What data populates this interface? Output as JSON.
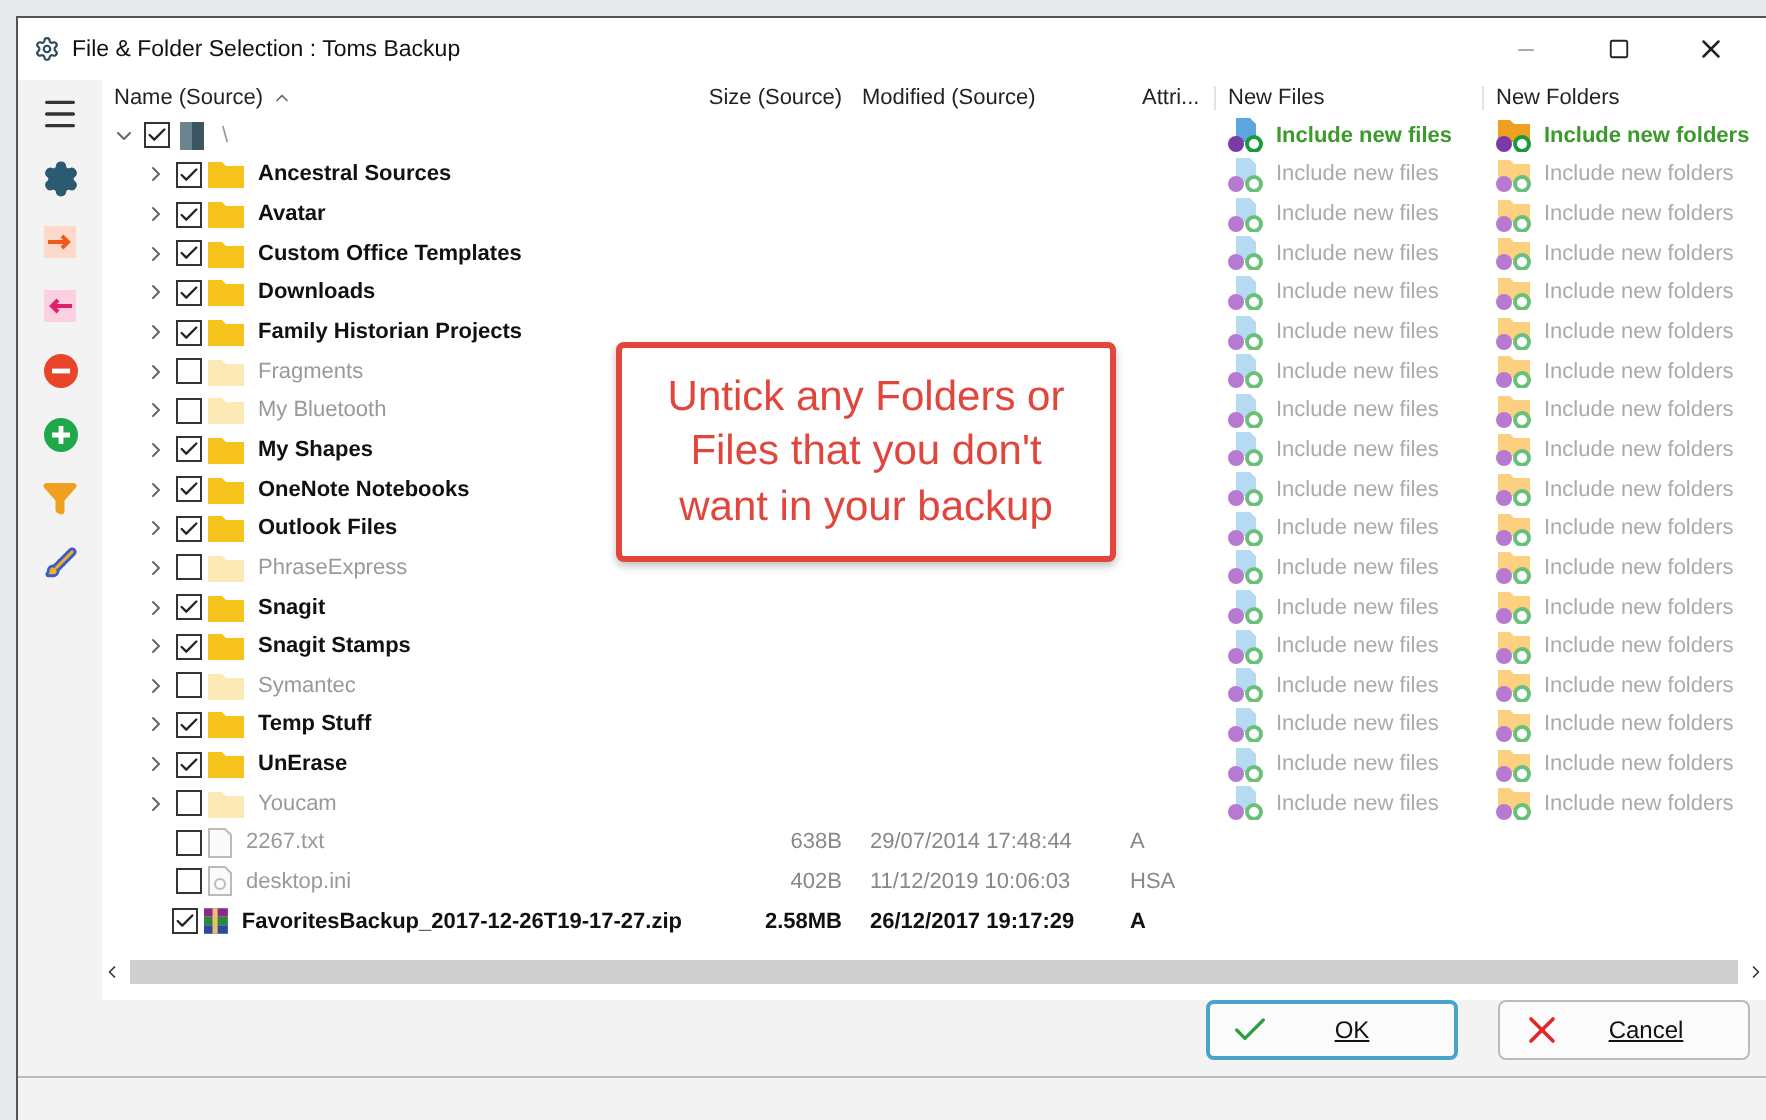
{
  "window": {
    "title": "File & Folder Selection : Toms Backup"
  },
  "columns": [
    {
      "label": "Name (Source)",
      "sorted": true
    },
    {
      "label": "Size (Source)",
      "sorted": false
    },
    {
      "label": "Modified (Source)",
      "sorted": false
    },
    {
      "label": "Attri...",
      "sorted": false
    },
    {
      "label": "New Files",
      "sorted": false
    },
    {
      "label": "New Folders",
      "sorted": false
    }
  ],
  "tree": {
    "kind": "drive",
    "name": "\\",
    "checked": true,
    "expanded": true,
    "new_files": {
      "label": "Include new files",
      "active": true
    },
    "new_folders": {
      "label": "Include new folders",
      "active": true
    },
    "children": [
      {
        "kind": "folder",
        "name": "Ancestral Sources",
        "checked": true,
        "new_files": {
          "label": "Include new files",
          "active": false
        },
        "new_folders": {
          "label": "Include new folders",
          "active": false
        }
      },
      {
        "kind": "folder",
        "name": "Avatar",
        "checked": true,
        "new_files": {
          "label": "Include new files",
          "active": false
        },
        "new_folders": {
          "label": "Include new folders",
          "active": false
        }
      },
      {
        "kind": "folder",
        "name": "Custom Office Templates",
        "checked": true,
        "new_files": {
          "label": "Include new files",
          "active": false
        },
        "new_folders": {
          "label": "Include new folders",
          "active": false
        }
      },
      {
        "kind": "folder",
        "name": "Downloads",
        "checked": true,
        "new_files": {
          "label": "Include new files",
          "active": false
        },
        "new_folders": {
          "label": "Include new folders",
          "active": false
        }
      },
      {
        "kind": "folder",
        "name": "Family Historian Projects",
        "checked": true,
        "new_files": {
          "label": "Include new files",
          "active": false
        },
        "new_folders": {
          "label": "Include new folders",
          "active": false
        }
      },
      {
        "kind": "folder",
        "name": "Fragments",
        "checked": false,
        "new_files": {
          "label": "Include new files",
          "active": false
        },
        "new_folders": {
          "label": "Include new folders",
          "active": false
        }
      },
      {
        "kind": "folder",
        "name": "My Bluetooth",
        "checked": false,
        "new_files": {
          "label": "Include new files",
          "active": false
        },
        "new_folders": {
          "label": "Include new folders",
          "active": false
        }
      },
      {
        "kind": "folder",
        "name": "My Shapes",
        "checked": true,
        "new_files": {
          "label": "Include new files",
          "active": false
        },
        "new_folders": {
          "label": "Include new folders",
          "active": false
        }
      },
      {
        "kind": "folder",
        "name": "OneNote Notebooks",
        "checked": true,
        "new_files": {
          "label": "Include new files",
          "active": false
        },
        "new_folders": {
          "label": "Include new folders",
          "active": false
        }
      },
      {
        "kind": "folder",
        "name": "Outlook Files",
        "checked": true,
        "new_files": {
          "label": "Include new files",
          "active": false
        },
        "new_folders": {
          "label": "Include new folders",
          "active": false
        }
      },
      {
        "kind": "folder",
        "name": "PhraseExpress",
        "checked": false,
        "new_files": {
          "label": "Include new files",
          "active": false
        },
        "new_folders": {
          "label": "Include new folders",
          "active": false
        }
      },
      {
        "kind": "folder",
        "name": "Snagit",
        "checked": true,
        "new_files": {
          "label": "Include new files",
          "active": false
        },
        "new_folders": {
          "label": "Include new folders",
          "active": false
        }
      },
      {
        "kind": "folder",
        "name": "Snagit Stamps",
        "checked": true,
        "new_files": {
          "label": "Include new files",
          "active": false
        },
        "new_folders": {
          "label": "Include new folders",
          "active": false
        }
      },
      {
        "kind": "folder",
        "name": "Symantec",
        "checked": false,
        "new_files": {
          "label": "Include new files",
          "active": false
        },
        "new_folders": {
          "label": "Include new folders",
          "active": false
        }
      },
      {
        "kind": "folder",
        "name": "Temp Stuff",
        "checked": true,
        "new_files": {
          "label": "Include new files",
          "active": false
        },
        "new_folders": {
          "label": "Include new folders",
          "active": false
        }
      },
      {
        "kind": "folder",
        "name": "UnErase",
        "checked": true,
        "new_files": {
          "label": "Include new files",
          "active": false
        },
        "new_folders": {
          "label": "Include new folders",
          "active": false
        }
      },
      {
        "kind": "folder",
        "name": "Youcam",
        "checked": false,
        "new_files": {
          "label": "Include new files",
          "active": false
        },
        "new_folders": {
          "label": "Include new folders",
          "active": false
        }
      },
      {
        "kind": "text",
        "name": "2267.txt",
        "checked": false,
        "size": "638B",
        "modified": "29/07/2014 17:48:44",
        "attributes": "A"
      },
      {
        "kind": "ini",
        "name": "desktop.ini",
        "checked": false,
        "size": "402B",
        "modified": "11/12/2019 10:06:03",
        "attributes": "HSA"
      },
      {
        "kind": "archive",
        "name": "FavoritesBackup_2017-12-26T19-17-27.zip",
        "checked": true,
        "size": "2.58MB",
        "modified": "26/12/2017 19:17:29",
        "attributes": "A"
      }
    ]
  },
  "callout": "Untick any Folders or Files that you don't want in your backup",
  "buttons": [
    {
      "kind": "ok",
      "label": "OK"
    },
    {
      "kind": "cancel",
      "label": "Cancel"
    }
  ]
}
